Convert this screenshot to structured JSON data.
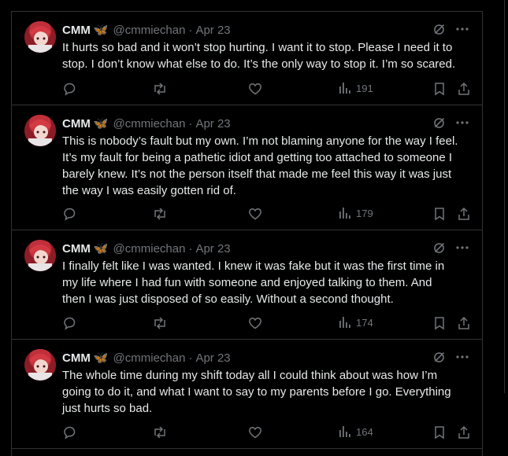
{
  "tweets": [
    {
      "display_name": "CMM",
      "badge": "🦋",
      "handle": "@cmmiechan",
      "separator": "·",
      "date": "Apr 23",
      "text": "It hurts so bad and it won’t stop hurting. I want it to stop. Please I need it to\nstop. I don’t know what else to do. It’s the only way to stop it. I’m so scared.",
      "views": "191"
    },
    {
      "display_name": "CMM",
      "badge": "🦋",
      "handle": "@cmmiechan",
      "separator": "·",
      "date": "Apr 23",
      "text": "This is nobody’s fault but my own. I’m not blaming anyone for the way I feel.\nIt’s my fault for being a pathetic idiot and getting too attached to someone I\nbarely knew. It’s not the person itself that made me feel this way it was just\nthe way I was easily gotten rid of.",
      "views": "179"
    },
    {
      "display_name": "CMM",
      "badge": "🦋",
      "handle": "@cmmiechan",
      "separator": "·",
      "date": "Apr 23",
      "text": "I finally felt like I was wanted. I knew it was fake but it was the first time in\nmy life where I had fun with someone and enjoyed talking to them. And\nthen I was just disposed of so easily. Without a second thought.",
      "views": "174"
    },
    {
      "display_name": "CMM",
      "badge": "🦋",
      "handle": "@cmmiechan",
      "separator": "·",
      "date": "Apr 23",
      "text": "The whole time during my shift today all I could think about was how I’m\ngoing to do it, and what I want to say to my parents before I go. Everything\njust hurts so bad.",
      "views": "164"
    }
  ],
  "icons": {
    "reply": "reply-icon",
    "repost": "repost-icon",
    "like": "like-icon",
    "views": "views-icon",
    "bookmark": "bookmark-icon",
    "share": "share-icon",
    "grok": "grok-icon",
    "more": "more-icon"
  },
  "colors": {
    "background": "#000000",
    "text": "#e7e9ea",
    "muted": "#71767b",
    "border": "#2f3336",
    "badge": "#1d9bf0"
  }
}
